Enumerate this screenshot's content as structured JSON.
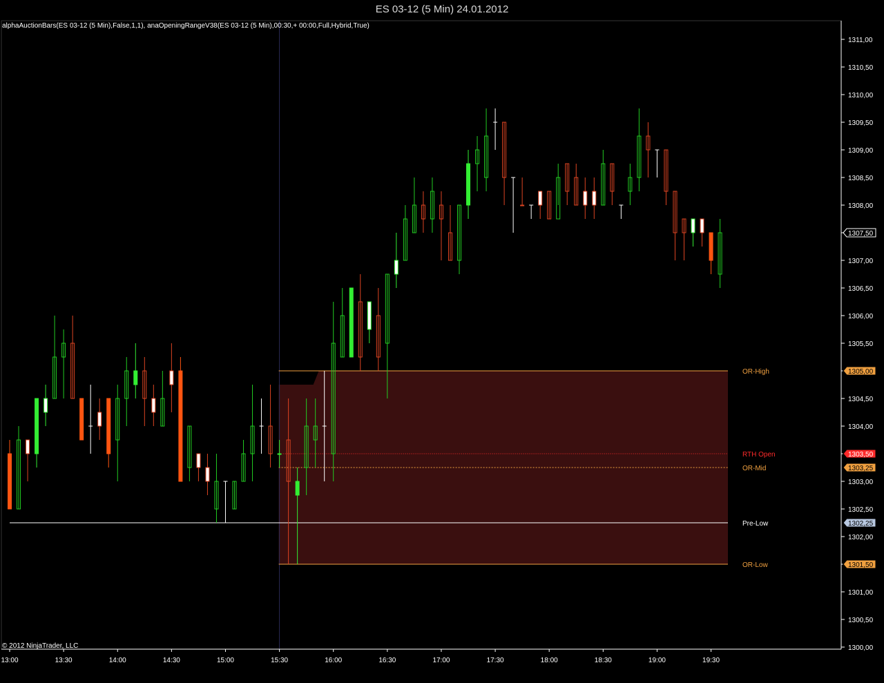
{
  "window": {
    "title": "ES 03-12 (5 Min)  24.01.2012"
  },
  "indicator_label": "alphaAuctionBars(ES 03-12 (5 Min),False,1,1), anaOpeningRangeV38(ES 03-12 (5 Min),00:30,+ 00:00,Full,Hybrid,True)",
  "copyright": "© 2012 NinjaTrader, LLC",
  "colors": {
    "background": "#000000",
    "axis": "#ffffff",
    "up_bar": "#22cc22",
    "strong_up": "#33ee33",
    "down_bar": "#dd4422",
    "strong_down": "#ff5511",
    "doji": "#ffffff",
    "or_fill": "#3a0f0f",
    "or_line": "#f0a040",
    "rth_open": "#ff2a2a",
    "pre_low": "#ffffff",
    "pre_low_tag": "#b8c8e0"
  },
  "chart_data": {
    "type": "candlestick",
    "symbol": "ES 03-12",
    "interval": "5 Min",
    "date": "24.01.2012",
    "ylim": [
      1300.0,
      1311.25
    ],
    "y_tick_step": 0.5,
    "y_tick_labels": [
      "1300,00",
      "1300,50",
      "1301,00",
      "1301,50",
      "1302,00",
      "1302,50",
      "1303,00",
      "1303,50",
      "1304,00",
      "1304,50",
      "1305,00",
      "1305,50",
      "1306,00",
      "1306,50",
      "1307,00",
      "1307,50",
      "1308,00",
      "1308,50",
      "1309,00",
      "1309,50",
      "1310,00",
      "1310,50",
      "1311,00"
    ],
    "x_tick_labels": [
      "13:00",
      "13:30",
      "14:00",
      "14:30",
      "15:00",
      "15:30",
      "16:00",
      "16:30",
      "17:00",
      "17:30",
      "18:00",
      "18:30",
      "19:00",
      "19:30"
    ],
    "x_tick_bar_index": [
      0,
      6,
      12,
      18,
      24,
      30,
      36,
      42,
      48,
      54,
      60,
      66,
      72,
      78
    ],
    "session_separator_bar_index": 30,
    "levels": [
      {
        "name": "OR-High",
        "value": 1305.0,
        "label": "1305,00",
        "style": "or"
      },
      {
        "name": "RTH Open",
        "value": 1303.5,
        "label": "1303,50",
        "style": "rth"
      },
      {
        "name": "OR-Mid",
        "value": 1303.25,
        "label": "1303,25",
        "style": "or"
      },
      {
        "name": "Pre-Low",
        "value": 1302.25,
        "label": "1302,25",
        "style": "pre"
      },
      {
        "name": "OR-Low",
        "value": 1301.5,
        "label": "1301,50",
        "style": "or"
      }
    ],
    "opening_range": {
      "high": 1305.0,
      "low": 1301.5,
      "start_bar_index": 31
    },
    "last_price": {
      "value": 1307.5,
      "label": "1307,50"
    },
    "bars": [
      [
        1303.5,
        1302.5,
        1303.75,
        1302.5,
        "sd"
      ],
      [
        1302.5,
        1303.75,
        1304.0,
        1302.5,
        "u"
      ],
      [
        1303.5,
        1303.75,
        1303.75,
        1303.0,
        "dj"
      ],
      [
        1303.5,
        1304.5,
        1304.5,
        1303.25,
        "su"
      ],
      [
        1304.25,
        1304.5,
        1304.75,
        1304.0,
        "uj"
      ],
      [
        1304.5,
        1305.25,
        1306.0,
        1304.5,
        "u"
      ],
      [
        1305.25,
        1305.5,
        1305.75,
        1304.5,
        "u"
      ],
      [
        1305.5,
        1304.5,
        1306.0,
        1304.5,
        "d"
      ],
      [
        1304.5,
        1303.75,
        1304.5,
        1303.75,
        "sd"
      ],
      [
        1304.0,
        1304.0,
        1304.75,
        1303.5,
        "dw"
      ],
      [
        1304.0,
        1304.25,
        1304.5,
        1303.75,
        "dj"
      ],
      [
        1304.5,
        1303.5,
        1304.5,
        1303.25,
        "sd"
      ],
      [
        1303.75,
        1304.5,
        1304.75,
        1303.0,
        "u"
      ],
      [
        1304.5,
        1305.0,
        1305.25,
        1304.0,
        "u"
      ],
      [
        1304.75,
        1305.0,
        1305.5,
        1304.5,
        "su"
      ],
      [
        1305.0,
        1304.5,
        1305.25,
        1304.0,
        "d"
      ],
      [
        1304.5,
        1304.25,
        1304.75,
        1304.0,
        "dj"
      ],
      [
        1304.0,
        1304.5,
        1305.0,
        1304.0,
        "u"
      ],
      [
        1304.75,
        1305.0,
        1305.5,
        1304.25,
        "dj"
      ],
      [
        1305.0,
        1303.0,
        1305.25,
        1303.0,
        "sd"
      ],
      [
        1303.25,
        1304.0,
        1304.0,
        1303.0,
        "u"
      ],
      [
        1303.5,
        1303.25,
        1303.5,
        1303.0,
        "dj"
      ],
      [
        1303.25,
        1303.0,
        1303.5,
        1302.75,
        "dj"
      ],
      [
        1302.5,
        1303.0,
        1303.5,
        1302.25,
        "u"
      ],
      [
        1303.0,
        1303.0,
        1303.0,
        1302.25,
        "w"
      ],
      [
        1302.5,
        1303.0,
        1303.0,
        1302.5,
        "u"
      ],
      [
        1303.0,
        1303.5,
        1303.75,
        1303.0,
        "u"
      ],
      [
        1303.5,
        1304.0,
        1304.75,
        1303.0,
        "u"
      ],
      [
        1303.5,
        1304.0,
        1304.5,
        1303.5,
        "w"
      ],
      [
        1304.0,
        1303.5,
        1304.75,
        1303.25,
        "d"
      ],
      [
        1303.5,
        1303.5,
        1303.75,
        1303.25,
        "su"
      ],
      [
        1303.75,
        1303.0,
        1304.5,
        1301.5,
        "d"
      ],
      [
        1303.0,
        1302.75,
        1303.25,
        1301.5,
        "su"
      ],
      [
        1303.25,
        1304.0,
        1304.5,
        1302.75,
        "u"
      ],
      [
        1303.75,
        1304.0,
        1304.5,
        1303.25,
        "u"
      ],
      [
        1303.5,
        1304.0,
        1305.0,
        1303.0,
        "w"
      ],
      [
        1303.5,
        1305.5,
        1306.25,
        1303.0,
        "u"
      ],
      [
        1305.25,
        1306.0,
        1306.5,
        1305.25,
        "u"
      ],
      [
        1305.25,
        1306.5,
        1306.5,
        1305.25,
        "su"
      ],
      [
        1306.25,
        1305.25,
        1306.75,
        1305.0,
        "d"
      ],
      [
        1305.75,
        1306.25,
        1306.25,
        1305.5,
        "uj"
      ],
      [
        1306.0,
        1305.25,
        1306.5,
        1305.0,
        "d"
      ],
      [
        1305.5,
        1306.75,
        1306.75,
        1304.5,
        "u"
      ],
      [
        1306.75,
        1307.0,
        1307.5,
        1306.5,
        "uj"
      ],
      [
        1307.0,
        1307.75,
        1308.0,
        1307.0,
        "u"
      ],
      [
        1307.5,
        1308.0,
        1308.5,
        1307.5,
        "u"
      ],
      [
        1308.0,
        1307.75,
        1308.25,
        1307.5,
        "d"
      ],
      [
        1307.75,
        1308.25,
        1308.5,
        1307.5,
        "u"
      ],
      [
        1308.0,
        1307.75,
        1308.25,
        1307.0,
        "d"
      ],
      [
        1307.5,
        1307.0,
        1308.0,
        1307.0,
        "d"
      ],
      [
        1307.0,
        1308.0,
        1308.0,
        1306.75,
        "u"
      ],
      [
        1308.0,
        1308.75,
        1309.0,
        1307.75,
        "su"
      ],
      [
        1308.75,
        1309.0,
        1309.25,
        1308.25,
        "u"
      ],
      [
        1308.5,
        1309.25,
        1309.75,
        1308.25,
        "u"
      ],
      [
        1309.5,
        1309.5,
        1309.75,
        1309.0,
        "w"
      ],
      [
        1309.5,
        1308.5,
        1309.5,
        1308.0,
        "d"
      ],
      [
        1308.5,
        1308.5,
        1308.5,
        1307.5,
        "dw"
      ],
      [
        1308.0,
        1308.0,
        1308.5,
        1308.0,
        "dj"
      ],
      [
        1308.0,
        1308.0,
        1308.0,
        1307.75,
        "dw"
      ],
      [
        1308.0,
        1308.25,
        1308.25,
        1307.75,
        "dj"
      ],
      [
        1308.25,
        1307.75,
        1308.25,
        1307.75,
        "d"
      ],
      [
        1307.75,
        1308.5,
        1308.75,
        1308.0,
        "u"
      ],
      [
        1308.75,
        1308.25,
        1308.75,
        1308.0,
        "d"
      ],
      [
        1308.5,
        1308.0,
        1308.75,
        1308.0,
        "d"
      ],
      [
        1308.0,
        1308.25,
        1308.5,
        1307.75,
        "dj"
      ],
      [
        1308.25,
        1308.0,
        1308.5,
        1307.75,
        "dj"
      ],
      [
        1308.0,
        1308.75,
        1309.0,
        1308.0,
        "u"
      ],
      [
        1308.75,
        1308.25,
        1308.75,
        1308.0,
        "d"
      ],
      [
        1308.0,
        1308.0,
        1308.0,
        1307.75,
        "dw"
      ],
      [
        1308.25,
        1308.5,
        1308.75,
        1308.0,
        "u"
      ],
      [
        1308.5,
        1309.25,
        1309.75,
        1308.25,
        "u"
      ],
      [
        1309.25,
        1309.0,
        1309.5,
        1308.5,
        "d"
      ],
      [
        1309.0,
        1308.75,
        1309.0,
        1308.5,
        "w"
      ],
      [
        1309.0,
        1308.25,
        1309.0,
        1308.0,
        "d"
      ],
      [
        1308.25,
        1307.5,
        1308.25,
        1307.0,
        "d"
      ],
      [
        1307.5,
        1307.75,
        1307.75,
        1307.0,
        "d"
      ],
      [
        1307.75,
        1307.5,
        1307.75,
        1307.25,
        "uj"
      ],
      [
        1307.5,
        1307.75,
        1307.75,
        1307.25,
        "dj"
      ],
      [
        1307.5,
        1307.0,
        1307.5,
        1306.75,
        "sd"
      ],
      [
        1306.75,
        1307.5,
        1307.75,
        1306.5,
        "u"
      ]
    ]
  }
}
